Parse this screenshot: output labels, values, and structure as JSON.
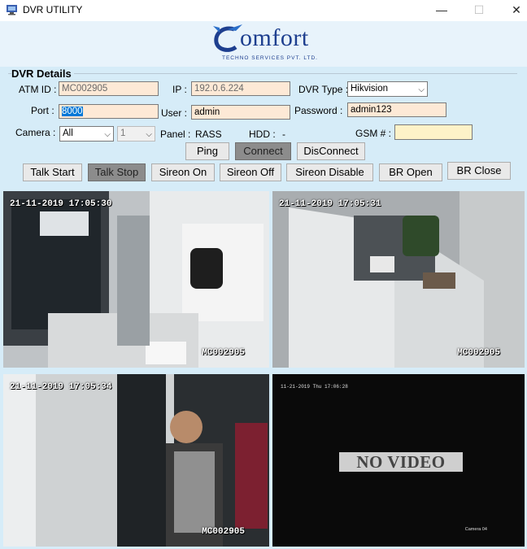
{
  "window": {
    "title": "DVR UTILITY",
    "minimize": "—",
    "maximize": "☐",
    "close": "✕"
  },
  "logo": {
    "word": "omfort",
    "initial": "C",
    "tagline": "TECHNO SERVICES PVT. LTD."
  },
  "form": {
    "group_title": "DVR Details",
    "atm_label": "ATM ID :",
    "atm_value": "MC002905",
    "ip_label": "IP :",
    "ip_value": "192.0.6.224",
    "dvr_type_label": "DVR Type :",
    "dvr_type_value": "Hikvision",
    "port_label": "Port :",
    "port_value": "8000",
    "user_label": "User :",
    "user_value": "admin",
    "password_label": "Password :",
    "password_value": "admin123",
    "camera_label": "Camera :",
    "camera_value": "All",
    "camera_number": "1",
    "panel_label": "Panel :",
    "panel_value": "RASS",
    "hdd_label": "HDD :",
    "hdd_value": "-",
    "gsm_label": "GSM # :",
    "gsm_value": ""
  },
  "buttons": {
    "ping": "Ping",
    "connect": "Connect",
    "disconnect": "DisConnect",
    "talk_start": "Talk Start",
    "talk_stop": "Talk Stop",
    "siren_on": "Sireon On",
    "siren_off": "Sireon Off",
    "siren_disable": "Sireon Disable",
    "br_open": "BR Open",
    "br_close": "BR Close"
  },
  "cameras": [
    {
      "timestamp": "21-11-2019 17:05:30",
      "id": "MC002905"
    },
    {
      "timestamp": "21-11-2019 17:05:31",
      "id": "MC002905"
    },
    {
      "timestamp": "21-11-2019 17:05:34",
      "id": "MC002905"
    },
    {
      "timestamp": "11-21-2019 Thu 17:06:28",
      "status": "NO VIDEO",
      "name": "Camera 04"
    }
  ],
  "colors": {
    "background": "#d6ecf8",
    "input_fill": "#fde9d6",
    "gsm_fill": "#fdf2c8",
    "logo_blue": "#1e3f8f",
    "pressed_button": "#8c8c8c"
  }
}
